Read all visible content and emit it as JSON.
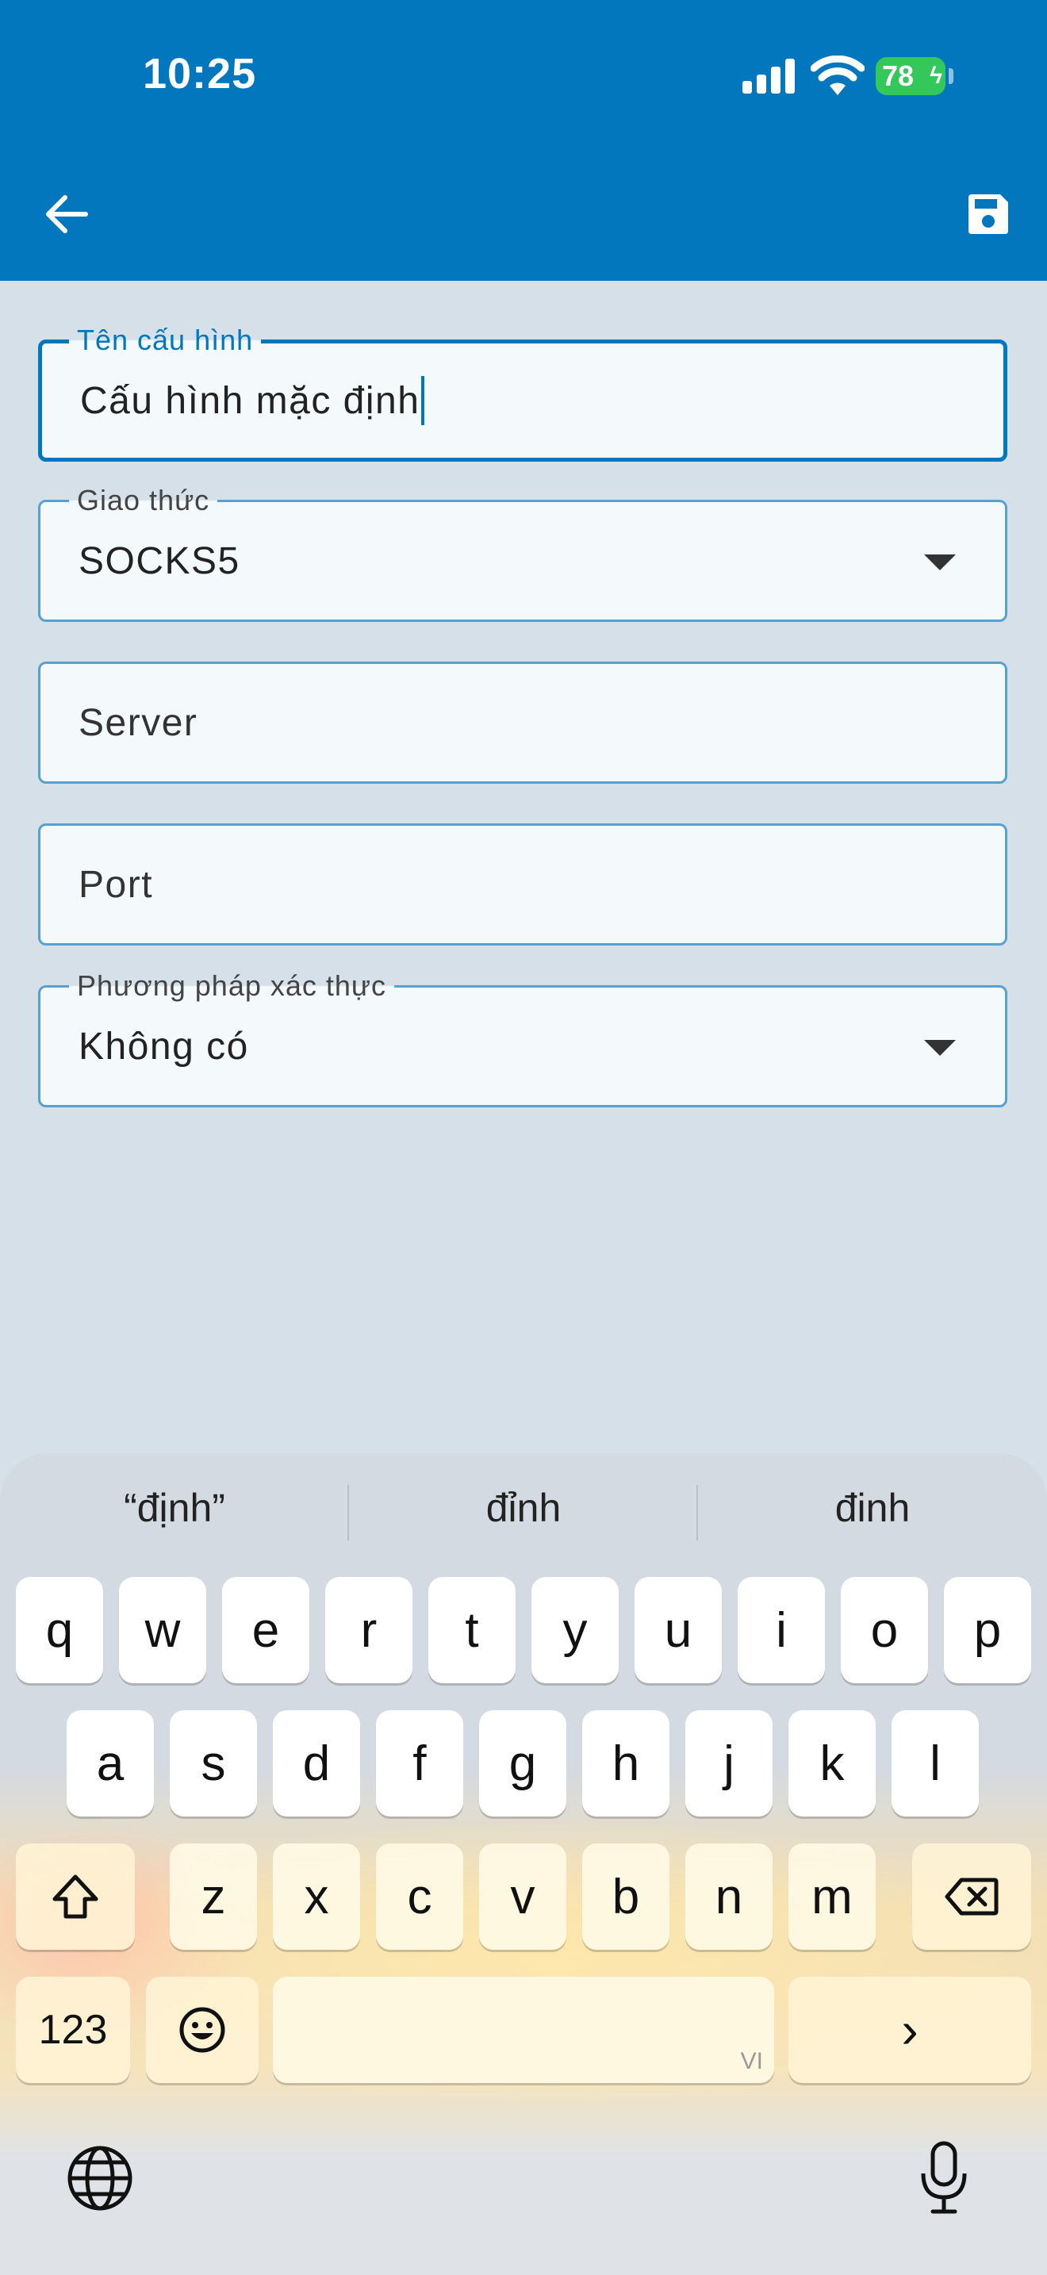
{
  "status_bar": {
    "time": "10:25",
    "battery": "78"
  },
  "appbar": {
    "back_icon": "arrow-left-icon",
    "save_icon": "floppy-disk-icon"
  },
  "form": {
    "config_name": {
      "label": "Tên cấu hình",
      "value": "Cấu hình mặc định"
    },
    "protocol": {
      "label": "Giao thức",
      "value": "SOCKS5"
    },
    "server": {
      "placeholder": "Server"
    },
    "port": {
      "placeholder": "Port"
    },
    "auth_method": {
      "label": "Phương pháp xác thực",
      "value": "Không có"
    }
  },
  "keyboard": {
    "suggestions": [
      "“định”",
      "đỉnh",
      "đinh"
    ],
    "row1": [
      "q",
      "w",
      "e",
      "r",
      "t",
      "y",
      "u",
      "i",
      "o",
      "p"
    ],
    "row2": [
      "a",
      "s",
      "d",
      "f",
      "g",
      "h",
      "j",
      "k",
      "l"
    ],
    "row3": [
      "z",
      "x",
      "c",
      "v",
      "b",
      "n",
      "m"
    ],
    "numbers_key": "123",
    "space_hint": "VI",
    "return_glyph": "›"
  },
  "colors": {
    "primary": "#0277bd",
    "background": "#d5e0e9",
    "battery": "#34c759"
  }
}
